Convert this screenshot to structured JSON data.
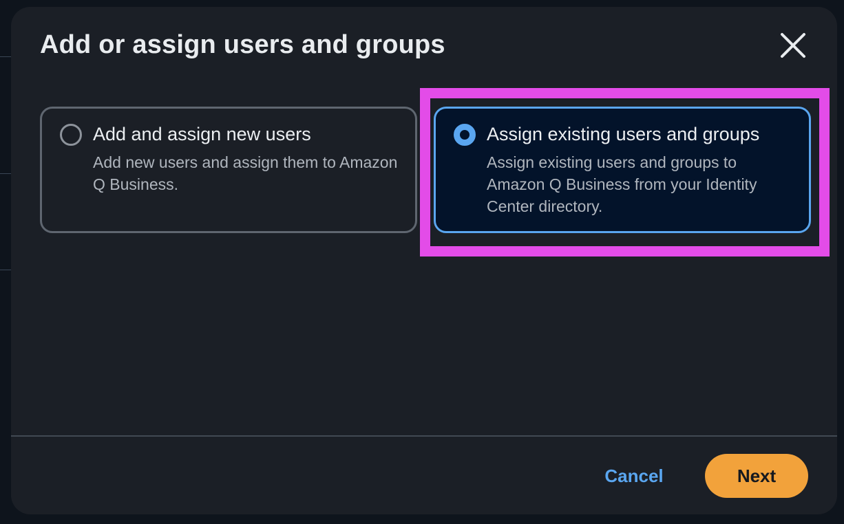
{
  "modal": {
    "title": "Add or assign users and groups"
  },
  "options": [
    {
      "title": "Add and assign new users",
      "description": "Add new users and assign them to Amazon Q Business.",
      "selected": false
    },
    {
      "title": "Assign existing users and groups",
      "description": "Assign existing users and groups to Amazon Q Business from your Identity Center directory.",
      "selected": true
    }
  ],
  "footer": {
    "cancel_label": "Cancel",
    "next_label": "Next"
  },
  "icons": {
    "close": "close-icon"
  },
  "colors": {
    "accent": "#5aa6f0",
    "primary_button": "#f2a23b",
    "highlight_annotation": "#e34ce8",
    "modal_background": "#1b1f26",
    "selected_card_background": "#03132a"
  }
}
